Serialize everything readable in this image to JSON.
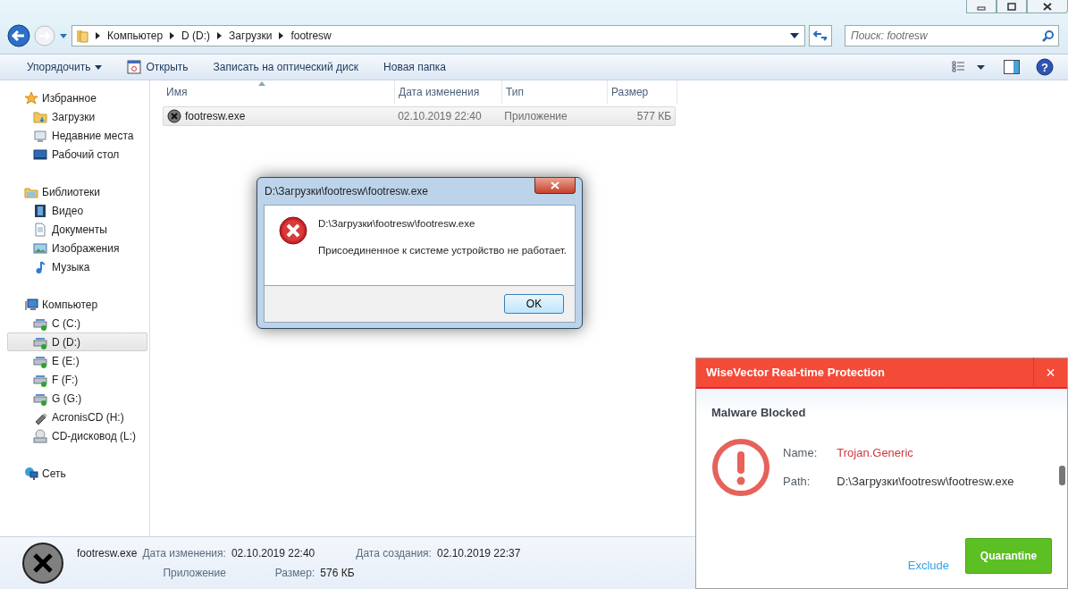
{
  "address_bar": {
    "crumbs": [
      "Компьютер",
      "D (D:)",
      "Загрузки",
      "footresw"
    ]
  },
  "search": {
    "placeholder": "Поиск: footresw"
  },
  "help_button": "?",
  "toolbar": {
    "buttons": [
      {
        "label": "Упорядочить",
        "kind": "menu"
      },
      {
        "label": "Открыть",
        "kind": "icon"
      },
      {
        "label": "Записать на оптический диск",
        "kind": "plain"
      },
      {
        "label": "Новая папка",
        "kind": "plain"
      }
    ]
  },
  "sidebar": {
    "groups": [
      {
        "label": "Избранное",
        "kind": "star",
        "children": [
          {
            "label": "Загрузки",
            "kind": "folder",
            "selected": false
          },
          {
            "label": "Недавние места",
            "kind": "recent",
            "selected": false
          },
          {
            "label": "Рабочий стол",
            "kind": "desktop",
            "selected": false
          }
        ]
      },
      {
        "label": "Библиотеки",
        "kind": "library",
        "children": [
          {
            "label": "Видео",
            "kind": "video",
            "selected": false
          },
          {
            "label": "Документы",
            "kind": "doc",
            "selected": false
          },
          {
            "label": "Изображения",
            "kind": "image",
            "selected": false
          },
          {
            "label": "Музыка",
            "kind": "music",
            "selected": false
          }
        ]
      },
      {
        "label": "Компьютер",
        "kind": "computer",
        "children": [
          {
            "label": "C (C:)",
            "kind": "drive",
            "selected": false
          },
          {
            "label": "D (D:)",
            "kind": "drive",
            "selected": true
          },
          {
            "label": "E (E:)",
            "kind": "drive",
            "selected": false
          },
          {
            "label": "F (F:)",
            "kind": "drive",
            "selected": false
          },
          {
            "label": "G (G:)",
            "kind": "drive",
            "selected": false
          },
          {
            "label": "AcronisCD (H:)",
            "kind": "usb",
            "selected": false
          },
          {
            "label": "CD-дисковод (L:)",
            "kind": "cd",
            "selected": false
          }
        ]
      },
      {
        "label": "Сеть",
        "kind": "network"
      }
    ]
  },
  "table": {
    "columns": [
      "Имя",
      "Дата изменения",
      "Тип",
      "Размер"
    ],
    "rows": [
      {
        "cells": [
          "footresw.exe",
          "02.10.2019 22:40",
          "Приложение",
          "577 КБ"
        ],
        "selected": true
      }
    ]
  },
  "details": {
    "name": "footresw.exe",
    "type": "Приложение",
    "fields": [
      {
        "label": "Дата изменения:",
        "value": "02.10.2019 22:40"
      },
      {
        "label": "Дата создания:",
        "value": "02.10.2019 22:37"
      },
      {
        "label": "Размер:",
        "value": "576 КБ"
      }
    ]
  },
  "error_dialog": {
    "title": "D:\\Загрузки\\footresw\\footresw.exe",
    "path": "D:\\Загрузки\\footresw\\footresw.exe",
    "message": "Присоединенное к системе устройство не работает.",
    "button": "OK"
  },
  "alert": {
    "title": "WiseVector Real-time Protection",
    "close": "×",
    "heading": "Malware Blocked",
    "fields": [
      {
        "label": "Name:",
        "value": "Trojan.Generic",
        "kind": "threat"
      },
      {
        "label": "Path:",
        "value": "D:\\Загрузки\\footresw\\footresw.exe",
        "kind": "plain"
      }
    ],
    "secondary": "Exclude",
    "primary": "Quarantine"
  }
}
